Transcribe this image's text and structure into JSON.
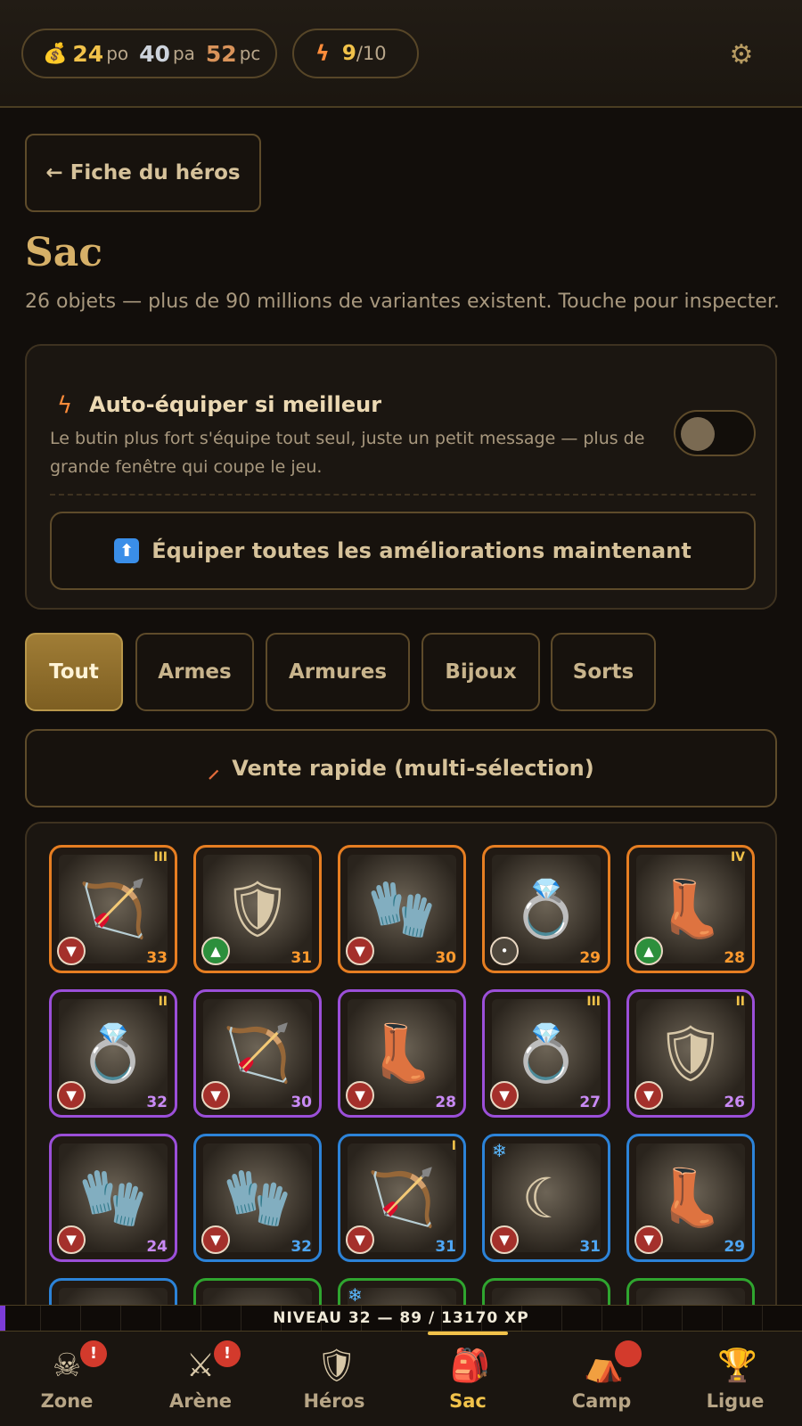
{
  "header": {
    "currency": [
      {
        "value": "24",
        "unit": "po"
      },
      {
        "value": "40",
        "unit": "pa"
      },
      {
        "value": "52",
        "unit": "pc"
      }
    ],
    "energy": {
      "current": "9",
      "max": "/10"
    }
  },
  "back_label": "← Fiche du héros",
  "title": "Sac",
  "subtitle": "26 objets — plus de 90 millions de variantes existent. Touche pour inspecter.",
  "auto_equip": {
    "title": "Auto-équiper si meilleur",
    "description": "Le butin plus fort s'équipe tout seul, juste un petit message — plus de grande fenêtre qui coupe le jeu.",
    "enabled": false,
    "equip_all_label": "Équiper toutes les améliorations maintenant"
  },
  "filters": [
    "Tout",
    "Armes",
    "Armures",
    "Bijoux",
    "Sorts"
  ],
  "active_filter": "Tout",
  "quick_sell_label": "Vente rapide (multi-sélection)",
  "rarity_colors": {
    "legendary": "#e67e22",
    "epic": "#9b4fd8",
    "rare": "#2c83d8",
    "uncommon": "#2fa52f"
  },
  "items": [
    {
      "name": "crossbow",
      "rarity": "legendary",
      "level": "33",
      "tier": "III",
      "compare": "down"
    },
    {
      "name": "breastplate",
      "rarity": "legendary",
      "level": "31",
      "tier": "",
      "compare": "up"
    },
    {
      "name": "gauntlets",
      "rarity": "legendary",
      "level": "30",
      "tier": "",
      "compare": "down"
    },
    {
      "name": "emerald-ring",
      "rarity": "legendary",
      "level": "29",
      "tier": "",
      "compare": "equal"
    },
    {
      "name": "greaves",
      "rarity": "legendary",
      "level": "28",
      "tier": "IV",
      "compare": "up"
    },
    {
      "name": "emerald-ring",
      "rarity": "epic",
      "level": "32",
      "tier": "II",
      "compare": "down"
    },
    {
      "name": "crossbow",
      "rarity": "epic",
      "level": "30",
      "tier": "",
      "compare": "down"
    },
    {
      "name": "greaves",
      "rarity": "epic",
      "level": "28",
      "tier": "",
      "compare": "down"
    },
    {
      "name": "emerald-ring",
      "rarity": "epic",
      "level": "27",
      "tier": "III",
      "compare": "down"
    },
    {
      "name": "breastplate",
      "rarity": "epic",
      "level": "26",
      "tier": "II",
      "compare": "down"
    },
    {
      "name": "gloves",
      "rarity": "epic",
      "level": "24",
      "tier": "",
      "compare": "down"
    },
    {
      "name": "gauntlets",
      "rarity": "rare",
      "level": "32",
      "tier": "",
      "compare": "down"
    },
    {
      "name": "bow",
      "rarity": "rare",
      "level": "31",
      "tier": "I",
      "compare": "down"
    },
    {
      "name": "sickle",
      "rarity": "rare",
      "level": "31",
      "tier": "",
      "compare": "down",
      "frost": true
    },
    {
      "name": "greaves",
      "rarity": "rare",
      "level": "29",
      "tier": "",
      "compare": "down"
    },
    {
      "name": "hidden",
      "rarity": "rare",
      "level": "",
      "tier": "",
      "compare": ""
    },
    {
      "name": "hidden",
      "rarity": "uncommon",
      "level": "",
      "tier": "",
      "compare": ""
    },
    {
      "name": "hidden",
      "rarity": "uncommon",
      "level": "",
      "tier": "",
      "compare": "",
      "frost": true
    },
    {
      "name": "hidden",
      "rarity": "uncommon",
      "level": "",
      "tier": "",
      "compare": ""
    },
    {
      "name": "hidden",
      "rarity": "uncommon",
      "level": "",
      "tier": "",
      "compare": ""
    }
  ],
  "xp": {
    "label": "NIVEAU 32 — 89 / 13170 XP",
    "fraction": 0.0068
  },
  "nav": [
    {
      "label": "Zone",
      "icon": "skull-icon",
      "alert": "!"
    },
    {
      "label": "Arène",
      "icon": "swords-icon",
      "alert": "!"
    },
    {
      "label": "Héros",
      "icon": "shield-icon",
      "alert": ""
    },
    {
      "label": "Sac",
      "icon": "backpack-icon",
      "alert": "",
      "active": true
    },
    {
      "label": "Camp",
      "icon": "camp-icon",
      "alert": " "
    },
    {
      "label": "Ligue",
      "icon": "trophy-icon",
      "alert": ""
    }
  ]
}
